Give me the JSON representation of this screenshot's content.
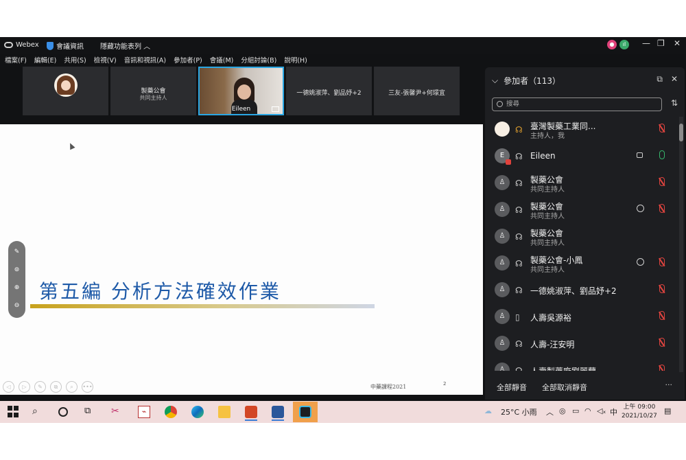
{
  "titlebar": {
    "app_name": "Webex",
    "meeting_info": "會議資訊",
    "hide_menu": "隱藏功能表列 ︿",
    "minimize": "—",
    "restore": "❐",
    "close": "✕"
  },
  "menu": [
    "檔案(F)",
    "編輯(E)",
    "共用(S)",
    "檢視(V)",
    "音訊和視訊(A)",
    "參加者(P)",
    "會議(M)",
    "分組討論(B)",
    "說明(H)"
  ],
  "filmstrip": {
    "tile2": {
      "name": "製藥公會",
      "role": "共同主持人"
    },
    "tile3": {
      "label": "Eileen"
    },
    "tile4": {
      "name": "一德姚淑萍、劉品妤+2"
    },
    "tile5": {
      "name": "三友-張馨尹+何璟宜"
    }
  },
  "slide": {
    "title": "第五編 分析方法確效作業",
    "footer": "中藥課程2021",
    "page": "2",
    "accent_blue": "#1e5aa8",
    "accent_gold": "#c8a21c"
  },
  "annotation_tools": [
    "✎",
    "⊚",
    "⊕",
    "⊖"
  ],
  "slide_nav": [
    "◁",
    "▷",
    "✎",
    "⧉",
    "⌕",
    "•••"
  ],
  "panel": {
    "title": "參加者（113）",
    "search_placeholder": "搜尋",
    "participants": [
      {
        "name": "臺灣製藥工業同...",
        "role": "主持人，我",
        "muted": true
      },
      {
        "name": "Eileen",
        "role": "",
        "muted": false,
        "video": true
      },
      {
        "name": "製藥公會",
        "role": "共同主持人",
        "muted": true
      },
      {
        "name": "製藥公會",
        "role": "共同主持人",
        "muted": true,
        "chat": true
      },
      {
        "name": "製藥公會",
        "role": "共同主持人",
        "muted": false
      },
      {
        "name": "製藥公會-小鳳",
        "role": "共同主持人",
        "muted": true,
        "chat": true
      },
      {
        "name": "一德姚淑萍、劉品妤+2",
        "role": "",
        "muted": true
      },
      {
        "name": "人壽吳源裕",
        "role": "",
        "muted": true
      },
      {
        "name": "人壽-汪安明",
        "role": "",
        "muted": true
      },
      {
        "name": "人壽製藥廠劉麗蘭",
        "role": "",
        "muted": true
      }
    ],
    "mute_all": "全部靜音",
    "unmute_all": "全部取消靜音",
    "more": "···"
  },
  "taskbar": {
    "weather": "25°C 小雨",
    "ime": "中",
    "time": "上午 09:00",
    "date": "2021/10/27"
  }
}
